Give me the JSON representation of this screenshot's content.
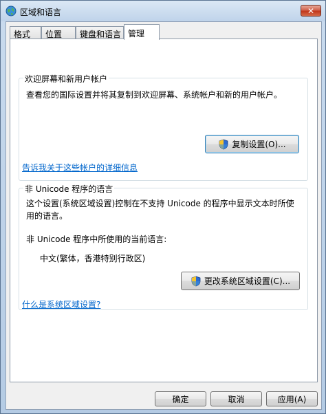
{
  "window": {
    "title": "区域和语言",
    "close_label": "✕"
  },
  "tabs": [
    {
      "label": "格式"
    },
    {
      "label": "位置"
    },
    {
      "label": "键盘和语言"
    },
    {
      "label": "管理"
    }
  ],
  "welcome_group": {
    "title": "欢迎屏幕和新用户帐户",
    "description": "查看您的国际设置并将其复制到欢迎屏幕、系统帐户和新的用户帐户。",
    "copy_button": "复制设置(O)...",
    "link": "告诉我关于这些帐户的详细信息"
  },
  "unicode_group": {
    "title": "非 Unicode 程序的语言",
    "description_line1": "这个设置(系统区域设置)控制在不支持 Unicode 的程序中显示文本时所使",
    "description_line2": "用的语言。",
    "current_label": "非 Unicode 程序中所使用的当前语言:",
    "current_value": "中文(繁体，香港特别行政区)",
    "change_button": "更改系统区域设置(C)...",
    "link": "什么是系统区域设置?"
  },
  "footer": {
    "ok": "确定",
    "cancel": "取消",
    "apply": "应用(A)"
  },
  "colors": {
    "link": "#0066cc",
    "accent": "#3c7fb1"
  }
}
